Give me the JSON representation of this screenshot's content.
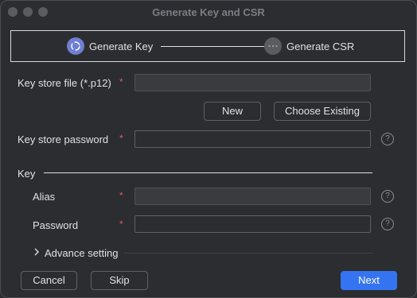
{
  "window": {
    "title": "Generate Key and CSR"
  },
  "steps": [
    {
      "label": "Generate Key"
    },
    {
      "label": "Generate CSR"
    }
  ],
  "keystore": {
    "file_label": "Key store file (*.p12)",
    "file_value": "",
    "password_label": "Key store password",
    "password_value": "",
    "new_label": "New",
    "choose_label": "Choose Existing",
    "required_mark": "*"
  },
  "key": {
    "section_label": "Key",
    "alias_label": "Alias",
    "alias_value": "",
    "password_label": "Password",
    "password_value": "",
    "advance_label": "Advance setting"
  },
  "footer": {
    "cancel_label": "Cancel",
    "skip_label": "Skip",
    "next_label": "Next"
  },
  "help_glyph": "?",
  "colors": {
    "accent": "#3574f0",
    "step_active": "#6f7fd1",
    "required": "#e55765",
    "background": "#2b2d30"
  }
}
